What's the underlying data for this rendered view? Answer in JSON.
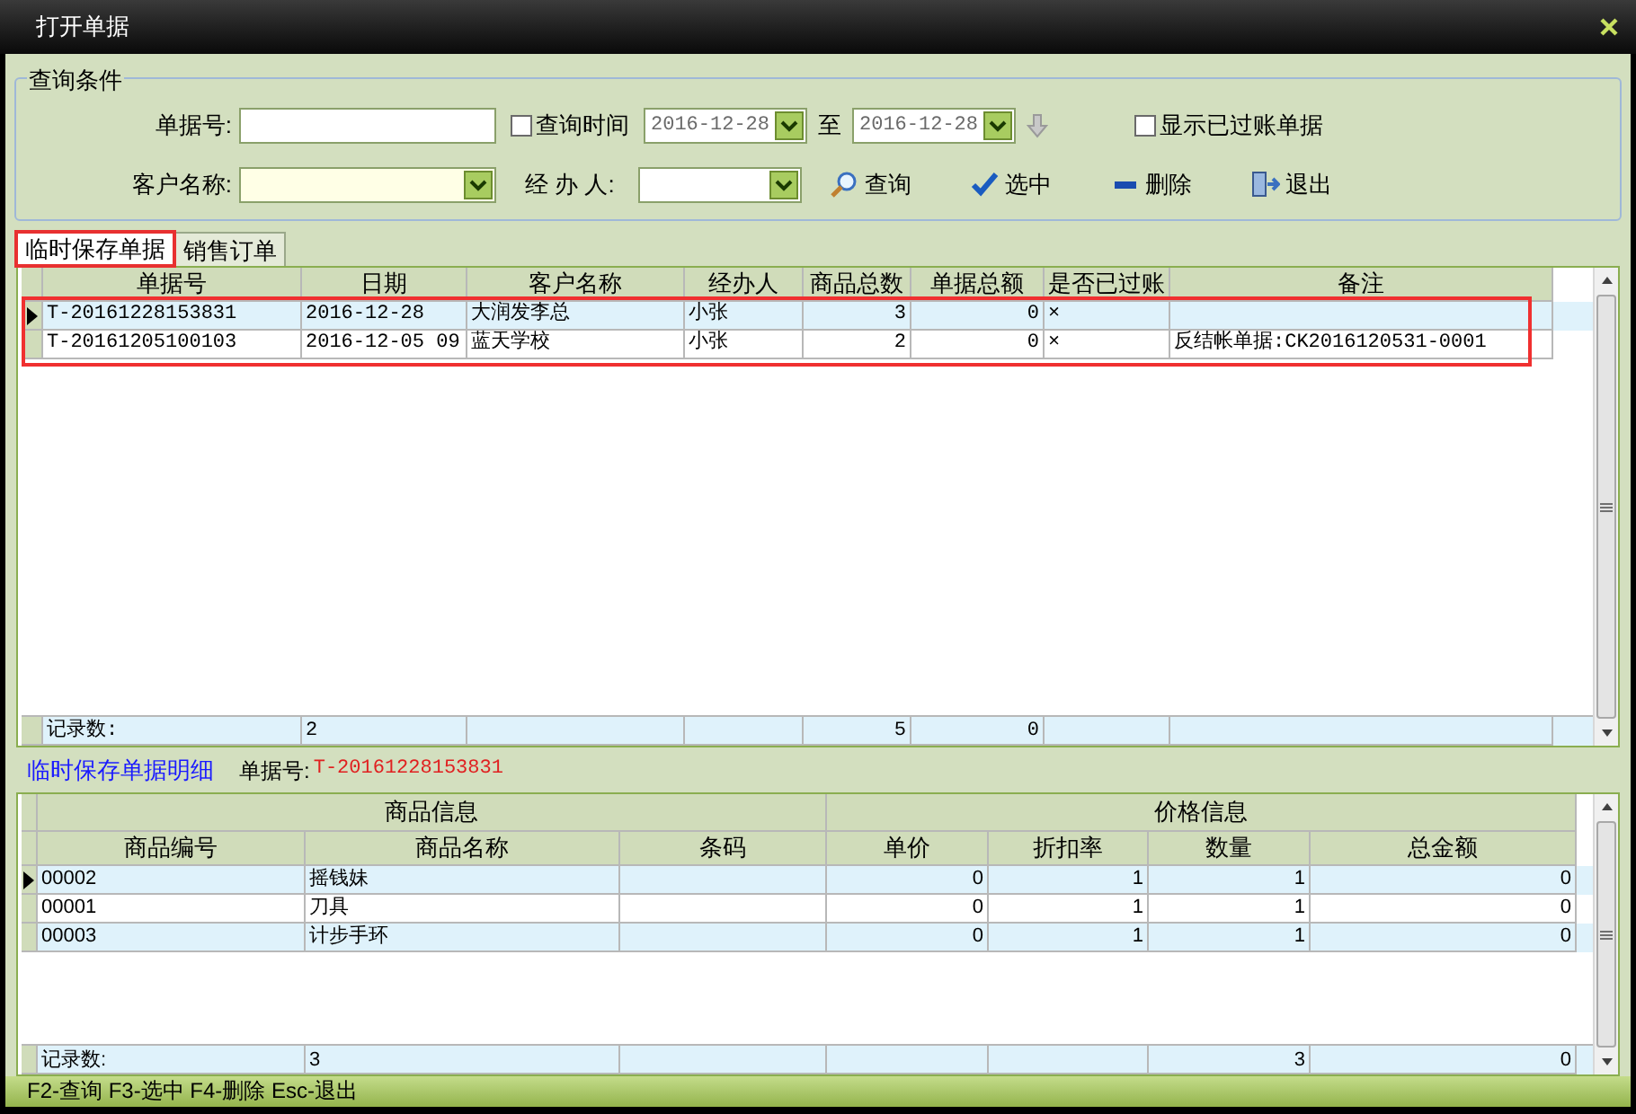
{
  "window": {
    "title": "打开单据"
  },
  "query": {
    "legend": "查询条件",
    "doc_no": {
      "label": "单据号:"
    },
    "query_time": {
      "label": "查询时间",
      "checked": false
    },
    "date_from": {
      "value": "2016-12-28"
    },
    "to_label": "至",
    "date_to": {
      "value": "2016-12-28"
    },
    "show_posted": {
      "label": "显示已过账单据",
      "checked": false
    },
    "customer": {
      "label": "客户名称:"
    },
    "handler": {
      "label": "经 办 人:"
    },
    "buttons": [
      {
        "kind": "search",
        "label": "查询"
      },
      {
        "kind": "select",
        "label": "选中"
      },
      {
        "kind": "delete",
        "label": "删除"
      },
      {
        "kind": "exit",
        "label": "退出"
      }
    ]
  },
  "tabs": [
    {
      "label": "临时保存单据",
      "selected": true
    },
    {
      "label": "销售订单",
      "selected": false
    }
  ],
  "orders": {
    "columns": [
      "单据号",
      "日期",
      "客户名称",
      "经办人",
      "商品总数",
      "单据总额",
      "是否已过账",
      "备注"
    ],
    "rows": [
      {
        "selected": true,
        "cells": [
          "T-20161228153831",
          "2016-12-28",
          "大润发李总",
          "小张",
          "3",
          "0",
          "×",
          null
        ]
      },
      {
        "selected": false,
        "cells": [
          "T-20161205100103",
          "2016-12-05 09",
          "蓝天学校",
          "小张",
          "2",
          "0",
          "×",
          "反结帐单据:CK2016120531-0001"
        ]
      }
    ],
    "summary": {
      "label": "记录数:",
      "count": "2",
      "quantity_total": "5",
      "amount_total": "0"
    }
  },
  "detail": {
    "title": "临时保存单据明细",
    "doc_label": "单据号:",
    "doc_no": "T-20161228153831",
    "groups": [
      "商品信息",
      "价格信息"
    ],
    "columns": [
      "商品编号",
      "商品名称",
      "条码",
      "单价",
      "折扣率",
      "数量",
      "总金额"
    ],
    "rows": [
      {
        "selected": true,
        "cells": [
          "00002",
          "摇钱妹",
          null,
          "0",
          "1",
          "1",
          "0"
        ]
      },
      {
        "selected": false,
        "cells": [
          "00001",
          "刀具",
          null,
          "0",
          "1",
          "1",
          "0"
        ]
      },
      {
        "selected": false,
        "cells": [
          "00003",
          "计步手环",
          null,
          "0",
          "1",
          "1",
          "0"
        ]
      }
    ],
    "summary": {
      "label": "记录数:",
      "count": "3",
      "quantity_total": "3",
      "amount_total": "0"
    }
  },
  "status_bar": "F2-查询 F3-选中 F4-删除 Esc-退出"
}
